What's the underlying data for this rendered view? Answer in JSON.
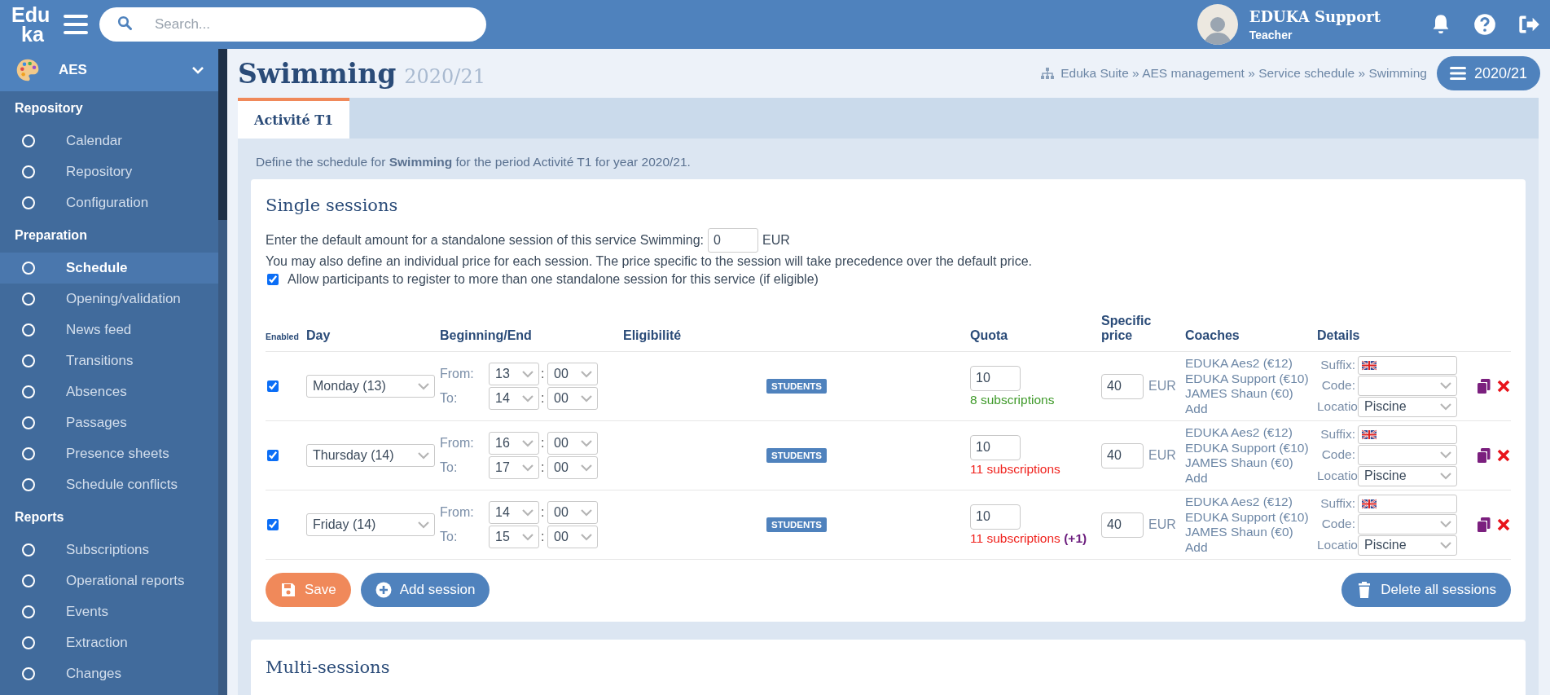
{
  "topbar": {
    "logo": [
      "Edu",
      "ka"
    ],
    "search": {
      "placeholder": "Search..."
    },
    "user": {
      "name": "EDUKA Support",
      "role": "Teacher"
    }
  },
  "sidebar": {
    "module": "AES",
    "sections": [
      {
        "title": "Repository",
        "items": [
          {
            "label": "Calendar",
            "selected": false
          },
          {
            "label": "Repository",
            "selected": false
          },
          {
            "label": "Configuration",
            "selected": false
          }
        ]
      },
      {
        "title": "Preparation",
        "items": [
          {
            "label": "Schedule",
            "selected": true
          },
          {
            "label": "Opening/validation",
            "selected": false
          },
          {
            "label": "News feed",
            "selected": false
          },
          {
            "label": "Transitions",
            "selected": false
          },
          {
            "label": "Absences",
            "selected": false
          },
          {
            "label": "Passages",
            "selected": false
          },
          {
            "label": "Presence sheets",
            "selected": false
          },
          {
            "label": "Schedule conflicts",
            "selected": false
          }
        ]
      },
      {
        "title": "Reports",
        "items": [
          {
            "label": "Subscriptions",
            "selected": false
          },
          {
            "label": "Operational reports",
            "selected": false
          },
          {
            "label": "Events",
            "selected": false
          },
          {
            "label": "Extraction",
            "selected": false
          },
          {
            "label": "Changes",
            "selected": false
          }
        ]
      }
    ]
  },
  "page": {
    "title": "Swimming",
    "year": "2020/21",
    "breadcrumb": "Eduka Suite » AES management » Service schedule » Swimming",
    "year_button": "2020/21"
  },
  "tabs": [
    {
      "label": "Activité T1",
      "selected": true
    }
  ],
  "description": "Define the schedule for **Swimming** for the period Activité T1 for year 2020/21.",
  "single_sessions": {
    "title": "Single sessions",
    "default_label": "Enter the default amount for a standalone session of this service Swimming:",
    "default_value": "0",
    "currency": "EUR",
    "note": "You may also define an individual price for each session. The price specific to the session will take precedence over the default price.",
    "allow_multiple": {
      "label": "Allow participants to register to more than one standalone session for this service (if eligible)",
      "checked": true
    },
    "columns": [
      "Enabled",
      "Day",
      "Beginning/End",
      "Eligibilité",
      "Quota",
      "Specific price",
      "Coaches",
      "Details"
    ],
    "rows": [
      {
        "enabled": true,
        "day": "Monday (13)",
        "separator": ":",
        "from_label": "From:",
        "to_label": "To:",
        "from_h": "13",
        "from_m": "00",
        "to_h": "14",
        "to_m": "00",
        "eligibility": "STUDENTS",
        "quota": "10",
        "subscriptions": {
          "text": "8 subscriptions",
          "color": "#3f9a2a"
        },
        "price": "40",
        "currency": "EUR",
        "coaches": [
          "EDUKA Aes2 (€12)",
          "EDUKA Support (€10)",
          "JAMES Shaun (€0)"
        ],
        "add": "Add",
        "suffix_label": "Suffix:",
        "code_label": "Code:",
        "location_label": "Locatio",
        "location": "Piscine"
      },
      {
        "enabled": true,
        "day": "Thursday (14)",
        "separator": ":",
        "from_label": "From:",
        "to_label": "To:",
        "from_h": "16",
        "from_m": "00",
        "to_h": "17",
        "to_m": "00",
        "eligibility": "STUDENTS",
        "quota": "10",
        "subscriptions": {
          "text": "11 subscriptions",
          "color": "#f0221d"
        },
        "price": "40",
        "currency": "EUR",
        "coaches": [
          "EDUKA Aes2 (€12)",
          "EDUKA Support (€10)",
          "JAMES Shaun (€0)"
        ],
        "add": "Add",
        "suffix_label": "Suffix:",
        "code_label": "Code:",
        "location_label": "Locatio",
        "location": "Piscine"
      },
      {
        "enabled": true,
        "day": "Friday (14)",
        "separator": ":",
        "from_label": "From:",
        "to_label": "To:",
        "from_h": "14",
        "from_m": "00",
        "to_h": "15",
        "to_m": "00",
        "eligibility": "STUDENTS",
        "quota": "10",
        "subscriptions": {
          "text": "11 subscriptions",
          "color": "#f0221d"
        },
        "extra": "(+1)",
        "price": "40",
        "currency": "EUR",
        "coaches": [
          "EDUKA Aes2 (€12)",
          "EDUKA Support (€10)",
          "JAMES Shaun (€0)"
        ],
        "add": "Add",
        "suffix_label": "Suffix:",
        "code_label": "Code:",
        "location_label": "Locatio",
        "location": "Piscine"
      }
    ],
    "buttons": {
      "save": "Save",
      "add": "Add session",
      "delete_all": "Delete all sessions"
    }
  },
  "multi_sessions": {
    "title": "Multi-sessions"
  }
}
